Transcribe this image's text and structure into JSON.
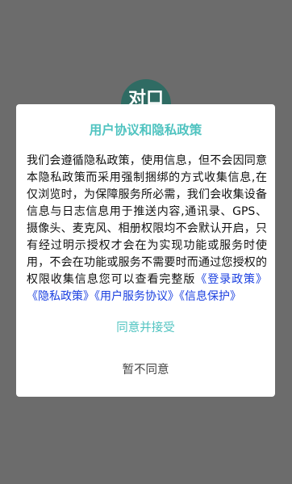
{
  "background_app": {
    "logo_text": "对口"
  },
  "dialog": {
    "title": "用户协议和隐私政策",
    "body_text": "我们会遵循隐私政策，使用信息，但不会因同意本隐私政策而采用强制捆绑的方式收集信息,在仅浏览时，为保障服务所必需，我们会收集设备信息与日志信息用于推送内容,通讯录、GPS、摄像头、麦克风、相册权限均不会默认开启，只有经过明示授权才会在为实现功能或服务时使用，不会在功能或服务不需要时而通过您授权的权限收集信息您可以查看完整版",
    "links": {
      "login_policy": "《登录政策》",
      "privacy_policy": "《隐私政策》",
      "user_service_agreement": "《用户服务协议》",
      "info_protection": "《信息保护》"
    },
    "agree_label": "同意并接受",
    "disagree_label": "暂不同意"
  },
  "colors": {
    "accent": "#4fc3c0",
    "link": "#1a3fe0",
    "overlay": "#6c6c6c"
  }
}
